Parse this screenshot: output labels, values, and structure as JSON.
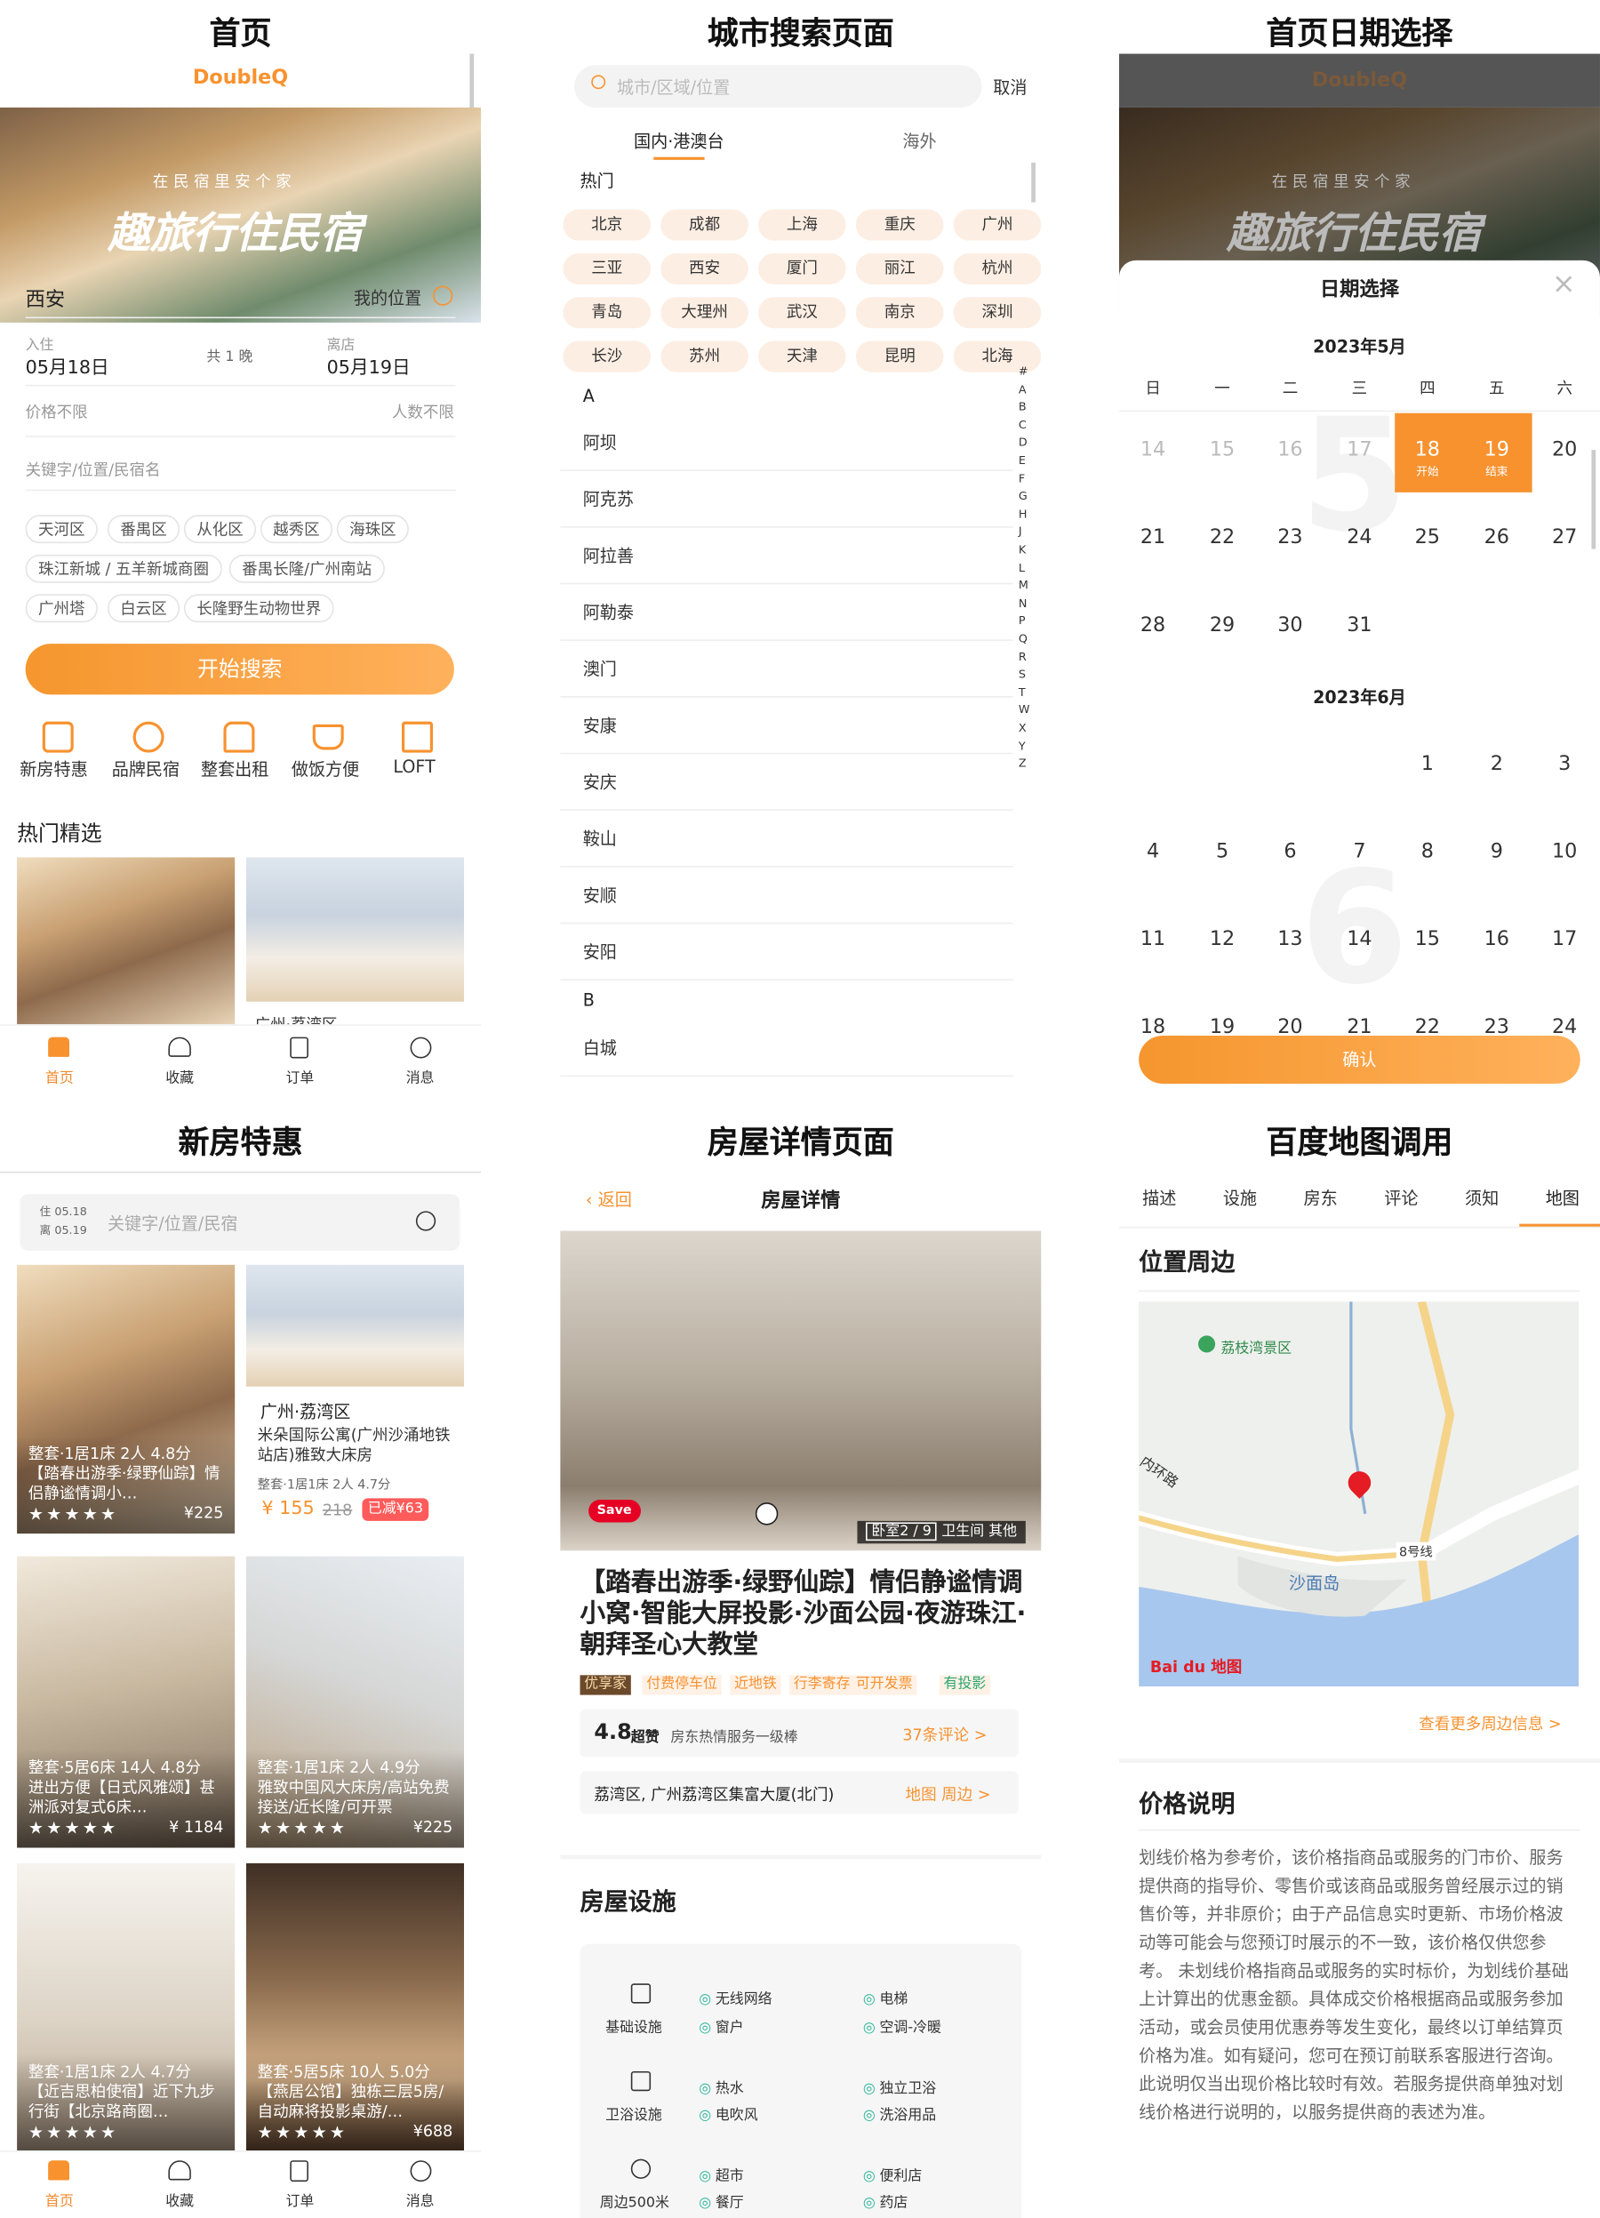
{
  "sections": {
    "home": "首页",
    "city_search": "城市搜索页面",
    "date_pick": "首页日期选择",
    "new_house": "新房特惠",
    "detail": "房屋详情页面",
    "map": "百度地图调用"
  },
  "home": {
    "brand": "DoubleQ",
    "slogan_small": "在 民 宿 里 安 个 家",
    "slogan_big": "趣旅行住民宿",
    "city": "西安",
    "my_location": "我的位置",
    "checkin_label": "入住",
    "checkin_date": "05月18日",
    "nights": "共 1 晚",
    "checkout_label": "离店",
    "checkout_date": "05月19日",
    "price": "价格不限",
    "people": "人数不限",
    "keyword_placeholder": "关键字/位置/民宿名",
    "tags": [
      "天河区",
      "番禺区",
      "从化区",
      "越秀区",
      "海珠区",
      "珠江新城 / 五羊新城商圈",
      "番禺长隆/广州南站",
      "广州塔",
      "白云区",
      "长隆野生动物世界"
    ],
    "search_button": "开始搜索",
    "categories": [
      "新房特惠",
      "品牌民宿",
      "整套出租",
      "做饭方便",
      "LOFT"
    ],
    "hot_title": "热门精选",
    "card_caption": "广州·荔湾区",
    "tabs": [
      "首页",
      "收藏",
      "订单",
      "消息"
    ]
  },
  "city": {
    "search_placeholder": "城市/区域/位置",
    "cancel": "取消",
    "tab_domestic": "国内·港澳台",
    "tab_overseas": "海外",
    "hot_label": "热门",
    "hot_cities": [
      "北京",
      "成都",
      "上海",
      "重庆",
      "广州",
      "三亚",
      "西安",
      "厦门",
      "丽江",
      "杭州",
      "青岛",
      "大理州",
      "武汉",
      "南京",
      "深圳",
      "长沙",
      "苏州",
      "天津",
      "昆明",
      "北海"
    ],
    "letter_a": "A",
    "a_cities": [
      "阿坝",
      "阿克苏",
      "阿拉善",
      "阿勒泰",
      "澳门",
      "安康",
      "安庆",
      "鞍山",
      "安顺",
      "安阳"
    ],
    "letter_b": "B",
    "b_cities": [
      "白城"
    ],
    "index_letters": [
      "#",
      "A",
      "B",
      "C",
      "D",
      "E",
      "F",
      "G",
      "H",
      "J",
      "K",
      "L",
      "M",
      "N",
      "P",
      "Q",
      "R",
      "S",
      "T",
      "W",
      "X",
      "Y",
      "Z"
    ]
  },
  "date": {
    "brand": "DoubleQ",
    "slogan_small": "在 民 宿 里 安 个 家",
    "slogan_big": "趣旅行住民宿",
    "title": "日期选择",
    "close": "×",
    "month1": "2023年5月",
    "weekdays": [
      "日",
      "一",
      "二",
      "三",
      "四",
      "五",
      "六"
    ],
    "may_watermark": "5",
    "may_rows": [
      [
        "14",
        "15",
        "16",
        "17",
        "18",
        "19",
        "20"
      ],
      [
        "21",
        "22",
        "23",
        "24",
        "25",
        "26",
        "27"
      ],
      [
        "28",
        "29",
        "30",
        "31",
        "",
        "",
        ""
      ]
    ],
    "start_label": "开始",
    "end_label": "结束",
    "month2": "2023年6月",
    "june_watermark": "6",
    "june_rows": [
      [
        "",
        "",
        "",
        "",
        "1",
        "2",
        "3"
      ],
      [
        "4",
        "5",
        "6",
        "7",
        "8",
        "9",
        "10"
      ],
      [
        "11",
        "12",
        "13",
        "14",
        "15",
        "16",
        "17"
      ],
      [
        "18",
        "19",
        "20",
        "21",
        "22",
        "23",
        "24"
      ]
    ],
    "confirm": "确认"
  },
  "newhouse": {
    "in_date": "住 05.18",
    "out_date": "离 05.19",
    "search_placeholder": "关键字/位置/民宿",
    "cards": [
      {
        "info": "整套·1居1床 2人 4.8分",
        "title": "【踏春出游季·绿野仙踪】情侣静谧情调小…",
        "price": "¥225"
      },
      {
        "loc": "广州·荔湾区",
        "title": "米朵国际公寓(广州沙涌地铁站店)雅致大床房",
        "info": "整套·1居1床 2人 4.7分",
        "price": "¥ 155",
        "old": "218",
        "discount": "已减¥63"
      },
      {
        "info": "整套·5居6床 14人 4.8分",
        "title": "进出方便【日式风雅颂】甚洲派对复式6床…",
        "price": "¥ 1184"
      },
      {
        "info": "整套·1居1床 2人 4.9分",
        "title": "雅致中国风大床房/高站免费接送/近长隆/可开票",
        "price": "¥225"
      },
      {
        "info": "整套·1居1床 2人 4.7分",
        "title": "【近吉思柏使宿】近下九步行街【北京路商圈…",
        "price": ""
      },
      {
        "info": "整套·5居5床 10人 5.0分",
        "title": "【燕居公馆】独栋三层5房/自动麻将投影桌游/…",
        "price": "¥688"
      }
    ],
    "stars": "★★★★★",
    "tabs": [
      "首页",
      "收藏",
      "订单",
      "消息"
    ]
  },
  "detail": {
    "back": "返回",
    "title": "房屋详情",
    "save": "Save",
    "photo_counter": "卧室2 / 9",
    "photo_tabs": [
      "卫生间",
      "其他"
    ],
    "headline": "【踏春出游季·绿野仙踪】情侣静谧情调小窝·智能大屏投影·沙面公园·夜游珠江·朝拜圣心大教堂",
    "badges": [
      "优享家",
      "付费停车位",
      "近地铁",
      "行李寄存",
      "可开发票",
      "有投影"
    ],
    "score": "4.8",
    "score_label": "超赞",
    "score_desc": "房东热情服务一级棒",
    "reviews": "37条评论 >",
    "address": "荔湾区, 广州荔湾区集富大厦(北门)",
    "map_link": "地图 周边 >",
    "facilities_title": "房屋设施",
    "facilities": [
      {
        "group": "基础设施",
        "items": [
          "无线网络",
          "电梯",
          "窗户",
          "空调-冷暖"
        ]
      },
      {
        "group": "卫浴设施",
        "items": [
          "热水",
          "独立卫浴",
          "电吹风",
          "洗浴用品"
        ]
      },
      {
        "group": "周边500米",
        "items": [
          "超市",
          "便利店",
          "餐厅",
          "药店"
        ]
      }
    ]
  },
  "map": {
    "tabs": [
      "描述",
      "设施",
      "房东",
      "评论",
      "须知",
      "地图"
    ],
    "nearby_title": "位置周边",
    "labels": {
      "park": "荔枝湾景区",
      "road": "内环路",
      "island": "沙面岛",
      "bridge": "8号线",
      "baidu": "Bai du 地图"
    },
    "more": "查看更多周边信息 >",
    "price_title": "价格说明",
    "price_text": "划线价格为参考价，该价格指商品或服务的门市价、服务提供商的指导价、零售价或该商品或服务曾经展示过的销售价等，并非原价；由于产品信息实时更新、市场价格波动等可能会与您预订时展示的不一致，该价格仅供您参考。 未划线价格指商品或服务的实时标价，为划线价基础上计算出的优惠金额。具体成交价格根据商品或服务参加活动，或会员使用优惠券等发生变化，最终以订单结算页价格为准。如有疑问，您可在预订前联系客服进行咨询。 此说明仅当出现价格比较时有效。若服务提供商单独对划线价格进行说明的，以服务提供商的表述为准。"
  },
  "colors": {
    "accent": "#f7922f",
    "accent_light": "#fdeee3",
    "accent_gradient_from": "#f5962e",
    "accent_gradient_to": "#ffb15c"
  }
}
